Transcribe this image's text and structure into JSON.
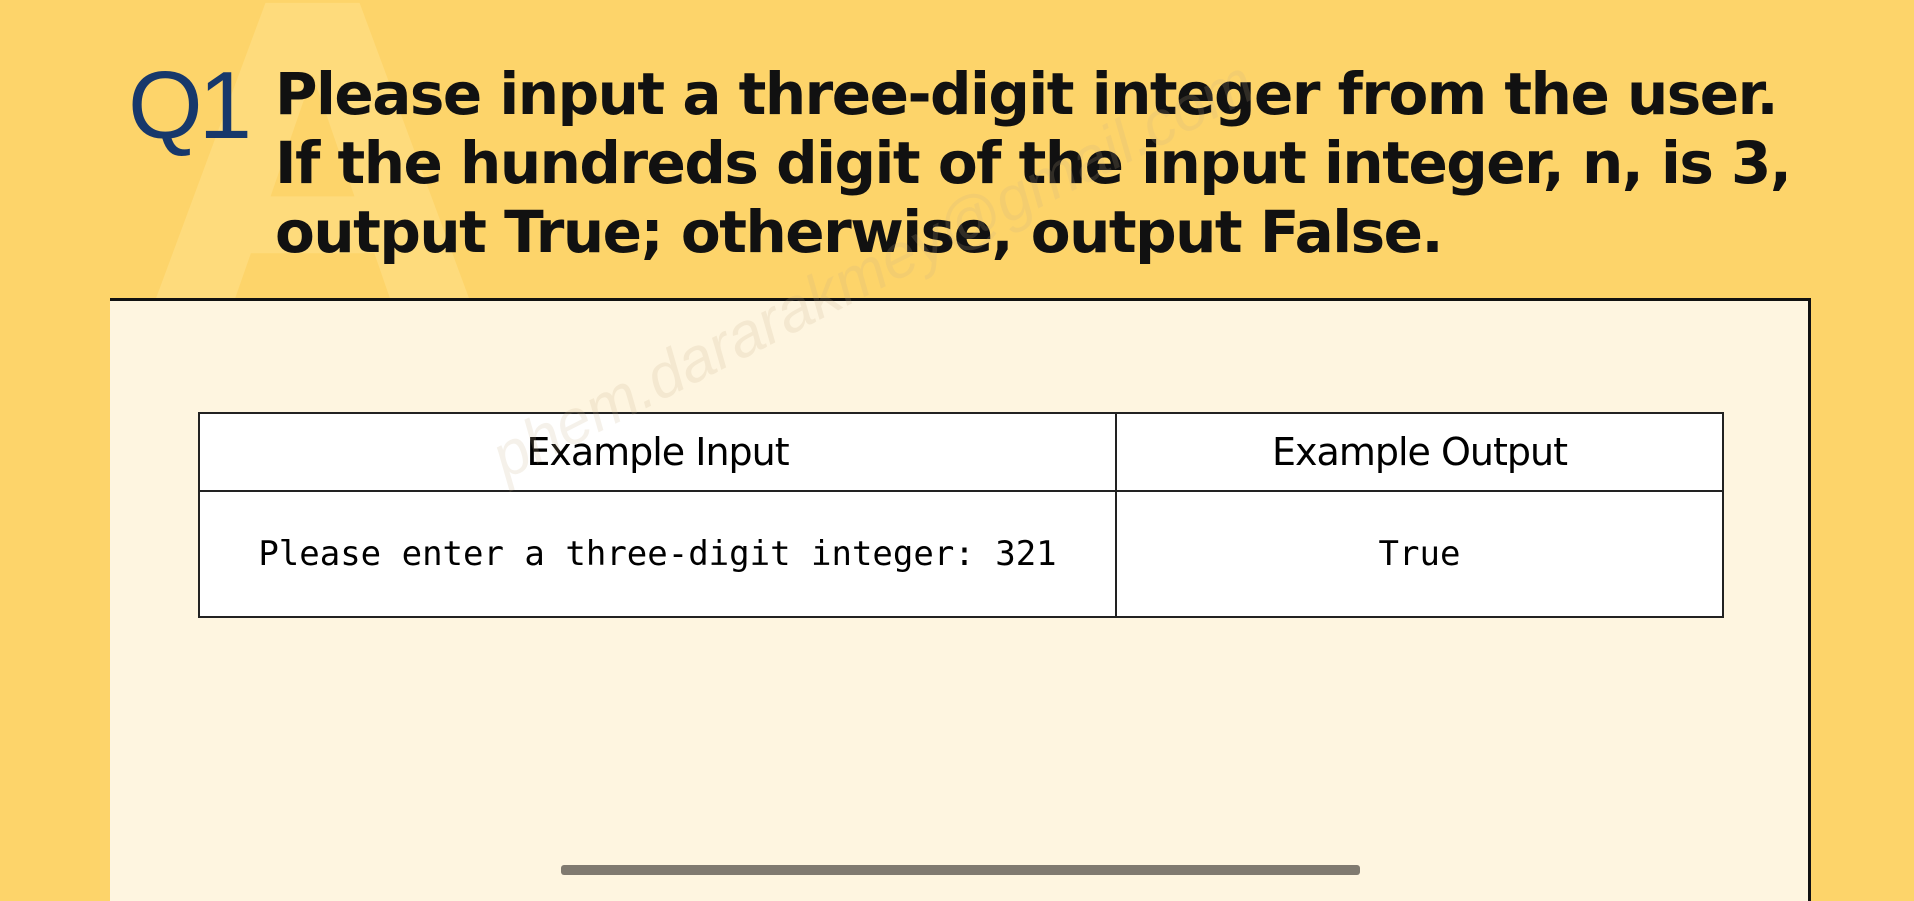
{
  "question": {
    "number": "Q1",
    "lines": [
      "Please input a three-digit integer from the user.",
      "If the hundreds digit of the input integer, n, is 3,",
      "output True; otherwise, output False."
    ]
  },
  "table": {
    "headers": [
      "Example Input",
      "Example Output"
    ],
    "rows": [
      [
        "Please enter a three-digit integer: 321",
        "True"
      ]
    ]
  },
  "watermark": "phem.dararakmey@gmail.com",
  "colors": {
    "background": "#fdd46a",
    "panel": "#fef5e0",
    "accent": "#17386b"
  }
}
